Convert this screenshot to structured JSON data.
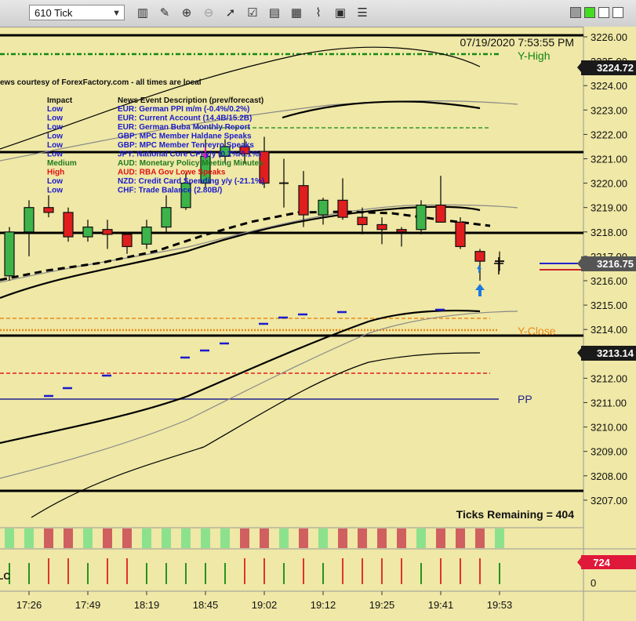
{
  "toolbar": {
    "interval": "610 Tick",
    "icons": [
      "bar-type-icon",
      "draw-icon",
      "zoom-in-icon",
      "zoom-out-icon",
      "pointer-icon",
      "properties-icon",
      "indicators-icon",
      "strategies-icon",
      "templates-icon",
      "data-box-icon",
      "tile-icon"
    ]
  },
  "colors": {
    "background": "#EFE8A6",
    "up_candle": "#3CB44A",
    "down_candle": "#E01E1E",
    "price_marker": "#555555",
    "volume_marker": "#E0183A"
  },
  "header": {
    "timestamp": "07/19/2020 7:53:55 PM"
  },
  "news": {
    "courtesy": "ews courtesy of ForexFactory.com - all times are local",
    "impact_header": "Impact",
    "desc_header": "News Event Description (prev/forecast)",
    "rows": [
      {
        "impact": "Low",
        "desc": "EUR: German PPI m/m (-0.4%/0.2%)",
        "color": "#1a1acc"
      },
      {
        "impact": "Low",
        "desc": "EUR: Current Account (14.4B/15.2B)",
        "color": "#1a1acc"
      },
      {
        "impact": "Low",
        "desc": "EUR: German Buba Monthly Report",
        "color": "#1a1acc"
      },
      {
        "impact": "Low",
        "desc": "GBP: MPC Member Haldane Speaks",
        "color": "#1a1acc"
      },
      {
        "impact": "Low",
        "desc": "GBP: MPC Member Tenreyro Speaks",
        "color": "#1a1acc"
      },
      {
        "impact": "Low",
        "desc": "JPY: National Core CPI y/y (0.2%/0.1%)",
        "color": "#1a1acc"
      },
      {
        "impact": "Medium",
        "desc": "AUD: Monetary Policy Meeting Minutes",
        "color": "#1f7a1f"
      },
      {
        "impact": "High",
        "desc": "AUD: RBA Gov Lowe Speaks",
        "color": "#e01010"
      },
      {
        "impact": "Low",
        "desc": "NZD: Credit Card Spending y/y (-21.1%)",
        "color": "#1a1acc"
      },
      {
        "impact": "Low",
        "desc": "CHF: Trade Balance (2.80B/)",
        "color": "#1a1acc"
      }
    ]
  },
  "chart_data": {
    "type": "candlestick",
    "ylim": [
      3206.5,
      3226.5
    ],
    "y_ticks": [
      "3226.00",
      "3225.00",
      "3224.00",
      "3223.00",
      "3222.00",
      "3221.00",
      "3220.00",
      "3219.00",
      "3218.00",
      "3217.00",
      "3216.00",
      "3215.00",
      "3214.00",
      "3213.00",
      "3212.00",
      "3211.00",
      "3210.00",
      "3209.00",
      "3208.00",
      "3207.00"
    ],
    "x_ticks": [
      "17:26",
      "17:49",
      "18:19",
      "18:45",
      "19:02",
      "19:12",
      "19:25",
      "19:41",
      "19:53"
    ],
    "candles": [
      {
        "o": 3216.2,
        "h": 3218.2,
        "l": 3216.0,
        "c": 3218.0
      },
      {
        "o": 3218.0,
        "h": 3219.3,
        "l": 3217.0,
        "c": 3219.0
      },
      {
        "o": 3219.0,
        "h": 3219.5,
        "l": 3218.6,
        "c": 3218.8
      },
      {
        "o": 3218.8,
        "h": 3219.0,
        "l": 3217.6,
        "c": 3217.8
      },
      {
        "o": 3217.8,
        "h": 3218.5,
        "l": 3217.6,
        "c": 3218.2
      },
      {
        "o": 3218.1,
        "h": 3218.5,
        "l": 3217.3,
        "c": 3217.9
      },
      {
        "o": 3217.9,
        "h": 3218.0,
        "l": 3217.1,
        "c": 3217.4
      },
      {
        "o": 3217.5,
        "h": 3218.5,
        "l": 3217.3,
        "c": 3218.2
      },
      {
        "o": 3218.2,
        "h": 3219.5,
        "l": 3218.0,
        "c": 3219.0
      },
      {
        "o": 3219.0,
        "h": 3220.4,
        "l": 3218.9,
        "c": 3220.0
      },
      {
        "o": 3220.0,
        "h": 3221.8,
        "l": 3219.8,
        "c": 3221.1
      },
      {
        "o": 3221.1,
        "h": 3221.8,
        "l": 3220.8,
        "c": 3221.5
      },
      {
        "o": 3221.5,
        "h": 3221.8,
        "l": 3220.8,
        "c": 3221.2
      },
      {
        "o": 3221.3,
        "h": 3221.9,
        "l": 3219.8,
        "c": 3220.0
      },
      {
        "o": 3220.0,
        "h": 3221.0,
        "l": 3219.0,
        "c": 3220.0
      },
      {
        "o": 3219.9,
        "h": 3220.5,
        "l": 3218.2,
        "c": 3218.7
      },
      {
        "o": 3218.7,
        "h": 3219.4,
        "l": 3218.3,
        "c": 3219.3
      },
      {
        "o": 3219.3,
        "h": 3220.2,
        "l": 3218.5,
        "c": 3218.6
      },
      {
        "o": 3218.6,
        "h": 3219.0,
        "l": 3217.9,
        "c": 3218.3
      },
      {
        "o": 3218.3,
        "h": 3218.6,
        "l": 3217.5,
        "c": 3218.1
      },
      {
        "o": 3218.1,
        "h": 3218.2,
        "l": 3217.4,
        "c": 3218.0
      },
      {
        "o": 3218.1,
        "h": 3219.3,
        "l": 3217.9,
        "c": 3219.1
      },
      {
        "o": 3219.1,
        "h": 3220.3,
        "l": 3218.4,
        "c": 3218.4
      },
      {
        "o": 3218.4,
        "h": 3218.6,
        "l": 3217.3,
        "c": 3217.4
      },
      {
        "o": 3217.2,
        "h": 3217.3,
        "l": 3216.0,
        "c": 3216.8
      },
      {
        "o": 3216.8,
        "h": 3217.2,
        "l": 3216.4,
        "c": 3216.8
      }
    ],
    "reference_lines": [
      {
        "label": "Y-High",
        "value": 3224.72,
        "marker": "3224.72",
        "color": "#118811",
        "style": "dashdot"
      },
      {
        "label": "Y-Close",
        "value": 3213.95,
        "marker": "",
        "color": "#E88A1A",
        "style": "dotted"
      },
      {
        "label": "PP",
        "value": 3211.05,
        "marker": "",
        "color": "#22228A",
        "style": "solid"
      },
      {
        "label": "",
        "value": 3213.14,
        "marker": "3213.14",
        "color": "#000000",
        "style": "solid"
      },
      {
        "label": "",
        "value": 3216.75,
        "marker": "3216.75",
        "color": "#555555",
        "style": "none"
      }
    ],
    "footer": "Ticks Remaining = 404",
    "volume_marker": "724",
    "volume_zero": "0",
    "volume_stub": "LC"
  }
}
